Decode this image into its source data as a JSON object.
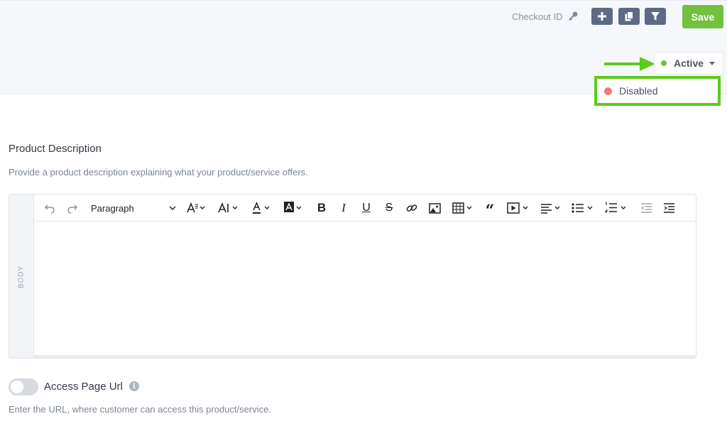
{
  "header": {
    "checkout_id_label": "Checkout ID",
    "save_label": "Save",
    "status": {
      "current": "Active",
      "options": [
        "Disabled"
      ]
    }
  },
  "product_description": {
    "title": "Product Description",
    "help": "Provide a product description explaining what your product/service offers."
  },
  "editor": {
    "side_label": "BODY",
    "block_format": "Paragraph"
  },
  "access_page": {
    "label": "Access Page Url",
    "enabled": false,
    "help": "Enter the URL, where customer can access this product/service."
  },
  "colors": {
    "save_green": "#72c13e",
    "active_dot": "#6ec03a",
    "disabled_dot": "#ef7c7c",
    "highlight": "#5ccb1c",
    "icon_button": "#5e6a82"
  }
}
